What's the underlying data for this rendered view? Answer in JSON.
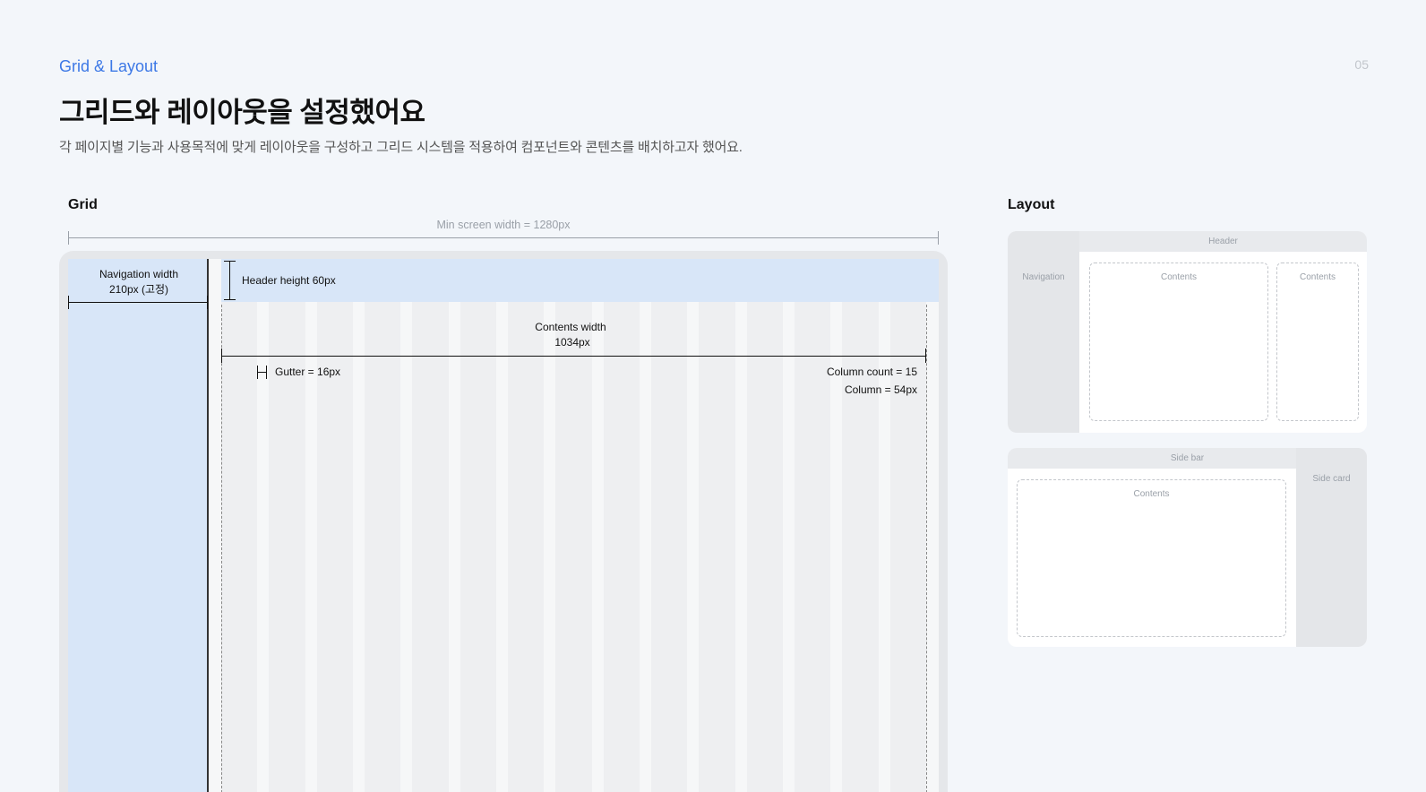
{
  "header": {
    "eyebrow": "Grid & Layout",
    "page_number": "05",
    "title": "그리드와 레이아웃을 설정했어요",
    "subtitle": "각 페이지별 기능과 사용목적에 맞게 레이아웃을 구성하고 그리드 시스템을 적용하여 컴포넌트와 콘텐츠를 배치하고자 했어요."
  },
  "grid": {
    "label": "Grid",
    "min_screen_width": "Min screen width = 1280px",
    "nav_width_line1": "Navigation width",
    "nav_width_line2": "210px (고정)",
    "header_height": "Header height 60px",
    "contents_width_line1": "Contents width",
    "contents_width_line2": "1034px",
    "gutter": "Gutter = 16px",
    "column_count": "Column count = 15",
    "column_width": "Column = 54px"
  },
  "layout": {
    "label": "Layout",
    "wireframe_a": {
      "header": "Header",
      "navigation": "Navigation",
      "contents_main": "Contents",
      "contents_side": "Contents"
    },
    "wireframe_b": {
      "sidebar": "Side bar",
      "side_card": "Side card",
      "contents": "Contents"
    }
  },
  "colors": {
    "accent": "#3c78e6",
    "highlight": "#d8e6f8",
    "background": "#f3f6fa"
  }
}
